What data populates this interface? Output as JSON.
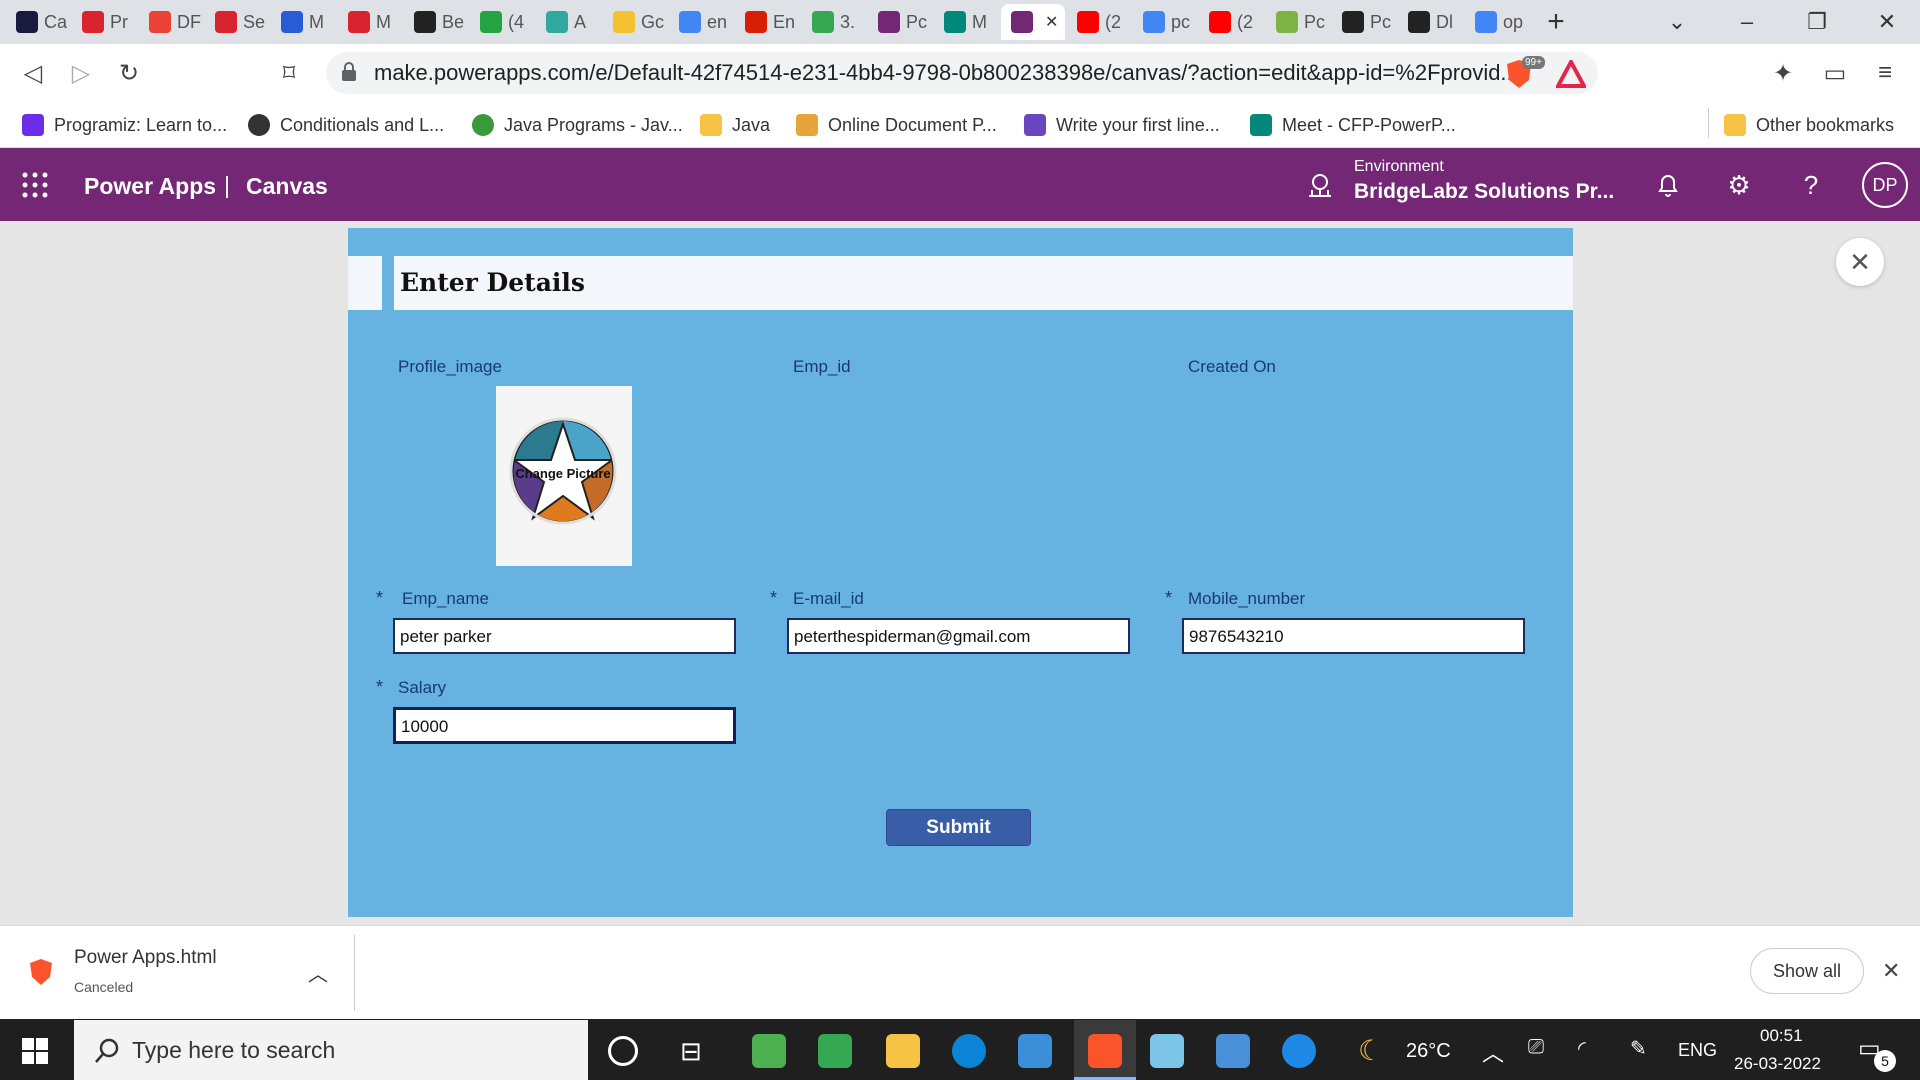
{
  "browser": {
    "tabs": [
      {
        "label": "Ca",
        "color": "#1a1a40"
      },
      {
        "label": "Pr",
        "color": "#d9232e"
      },
      {
        "label": "DF",
        "color": "#ea4335"
      },
      {
        "label": "Se",
        "color": "#d9232e"
      },
      {
        "label": "M",
        "color": "#2a5bd7"
      },
      {
        "label": "M",
        "color": "#d9232e"
      },
      {
        "label": "Be",
        "color": "#222222"
      },
      {
        "label": "(4",
        "color": "#25a244"
      },
      {
        "label": "A",
        "color": "#2ea8a0"
      },
      {
        "label": "Gc",
        "color": "#f6c12e"
      },
      {
        "label": "en",
        "color": "#4285f4"
      },
      {
        "label": "En",
        "color": "#d81e05"
      },
      {
        "label": "3.",
        "color": "#34a853"
      },
      {
        "label": "Pc",
        "color": "#742774"
      },
      {
        "label": "M",
        "color": "#00897b"
      },
      {
        "label": "",
        "color": "#742774"
      },
      {
        "label": "(2",
        "color": "#ff0000"
      },
      {
        "label": "pc",
        "color": "#4285f4"
      },
      {
        "label": "(2",
        "color": "#ff0000"
      },
      {
        "label": "Pc",
        "color": "#7cb342"
      },
      {
        "label": "Pc",
        "color": "#222222"
      },
      {
        "label": "Dl",
        "color": "#222222"
      },
      {
        "label": "op",
        "color": "#4285f4"
      }
    ],
    "new_tab_glyph": "+",
    "url": "make.powerapps.com/e/Default-42f74514-e231-4bb4-9798-0b800238398e/canvas/?action=edit&app-id=%2Fprovid...",
    "shield_badge": "99+",
    "bookmarks": [
      "Programiz: Learn to...",
      "Conditionals and L...",
      "Java Programs - Jav...",
      "Java",
      "Online Document P...",
      "Write your first line...",
      "Meet - CFP-PowerP..."
    ],
    "other_bookmarks": "Other bookmarks"
  },
  "powerapps": {
    "app_name": "Power Apps",
    "separator": "|",
    "mode": "Canvas",
    "environment_label": "Environment",
    "environment_name": "BridgeLabz Solutions Pr...",
    "avatar_initials": "DP"
  },
  "form": {
    "title": "Enter Details",
    "labels": {
      "profile_image": "Profile_image",
      "emp_id": "Emp_id",
      "created_on": "Created On",
      "emp_name": "Emp_name",
      "email_id": "E-mail_id",
      "mobile_number": "Mobile_number",
      "salary": "Salary"
    },
    "required_mark": "*",
    "image_button": "Change Picture",
    "values": {
      "emp_name": "peter parker",
      "email_id": "peterthespiderman@gmail.com",
      "mobile_number": "9876543210",
      "salary": "10000"
    },
    "submit_label": "Submit",
    "accent_color": "#66b3e1"
  },
  "download_bar": {
    "file_name": "Power Apps.html",
    "status": "Canceled",
    "show_all": "Show all"
  },
  "taskbar": {
    "search_placeholder": "Type here to search",
    "weather": "26°C",
    "language": "ENG",
    "time": "00:51",
    "date": "26-03-2022",
    "notification_count": "5"
  }
}
